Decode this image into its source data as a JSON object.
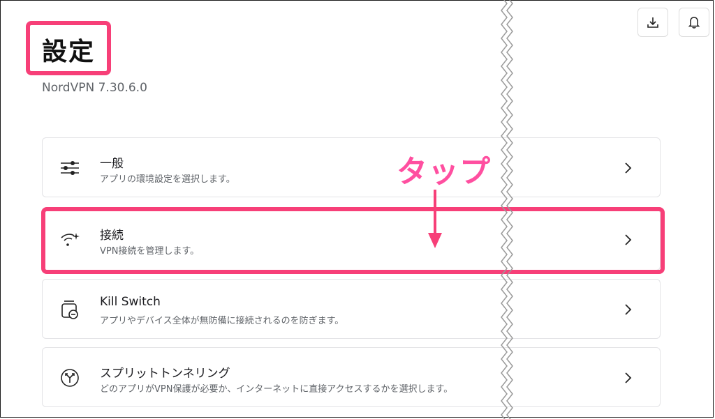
{
  "header": {
    "title": "設定",
    "version": "NordVPN 7.30.6.0"
  },
  "toolbar": {
    "download_icon": "download-icon",
    "bell_icon": "bell-icon"
  },
  "annotation": {
    "text": "タップ",
    "color": "#ff4fa0"
  },
  "settings": {
    "items": [
      {
        "icon": "sliders-icon",
        "label": "一般",
        "description": "アプリの環境設定を選択します。"
      },
      {
        "icon": "wifi-sparkle-icon",
        "label": "接続",
        "description": "VPN接続を管理します。"
      },
      {
        "icon": "kill-switch-icon",
        "label": "Kill Switch",
        "description": "アプリやデバイス全体が無防備に接続されるのを防ぎます。"
      },
      {
        "icon": "split-tunnel-icon",
        "label": "スプリットトンネリング",
        "description": "どのアプリがVPN保護が必要か、インターネットに直接アクセスするかを選択します。"
      }
    ]
  },
  "colors": {
    "highlight": "#f73f78",
    "text_primary": "#1b1b1f",
    "text_secondary": "#5f6368"
  }
}
